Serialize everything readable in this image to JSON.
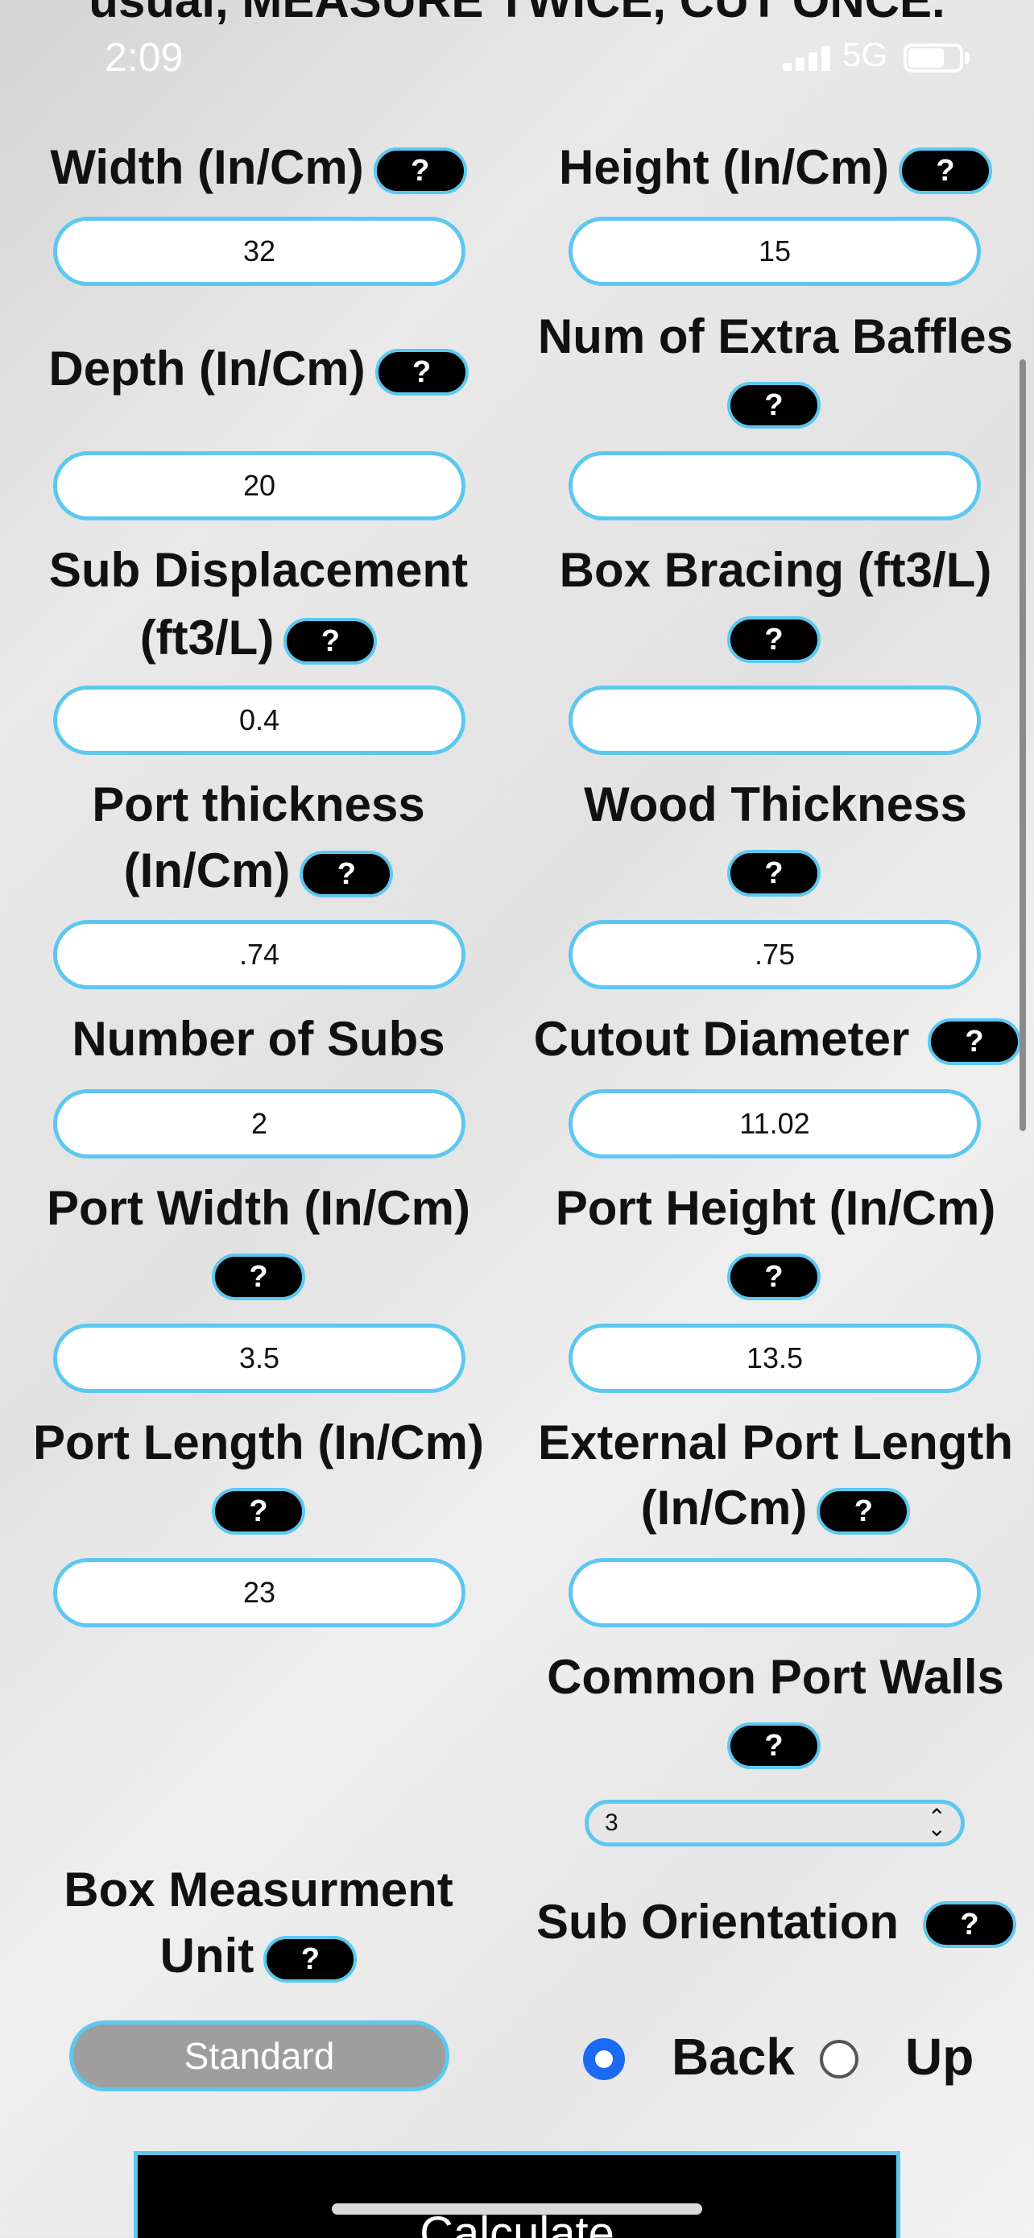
{
  "header": {
    "scrolled_text": "usual, MEASURE TWICE, CUT ONCE."
  },
  "status_bar": {
    "time": "2:09",
    "network": "5G"
  },
  "help_label": "?",
  "fields": {
    "width": {
      "label": "Width (In/Cm)",
      "value": "32"
    },
    "height": {
      "label": "Height (In/Cm)",
      "value": "15"
    },
    "depth": {
      "label": "Depth (In/Cm)",
      "value": "20"
    },
    "extra_baffles": {
      "label": "Num of Extra Baffles",
      "value": ""
    },
    "sub_displacement": {
      "label_line1": "Sub Displacement",
      "label_line2": "(ft3/L)",
      "value": "0.4"
    },
    "box_bracing": {
      "label": "Box Bracing (ft3/L)",
      "value": ""
    },
    "port_thickness": {
      "label_line1": "Port thickness",
      "label_line2": "(In/Cm)",
      "value": ".74"
    },
    "wood_thickness": {
      "label": "Wood Thickness",
      "value": ".75"
    },
    "num_subs": {
      "label": "Number of Subs",
      "value": "2"
    },
    "cutout_diameter": {
      "label": "Cutout Diameter",
      "value": "11.02"
    },
    "port_width": {
      "label": "Port Width (In/Cm)",
      "value": "3.5"
    },
    "port_height": {
      "label": "Port Height (In/Cm)",
      "value": "13.5"
    },
    "port_length": {
      "label": "Port Length (In/Cm)",
      "value": "23"
    },
    "external_port_length": {
      "label_line1": "External Port Length",
      "label_line2": "(In/Cm)",
      "value": ""
    }
  },
  "common_port_walls": {
    "label": "Common Port Walls",
    "selected": "3"
  },
  "box_unit": {
    "label_line1": "Box Measurment",
    "label_line2": "Unit",
    "button": "Standard"
  },
  "sub_orientation": {
    "label": "Sub Orientation",
    "options": [
      "Back",
      "Up"
    ],
    "selected": "Back"
  },
  "calculate_label": "Calculate"
}
